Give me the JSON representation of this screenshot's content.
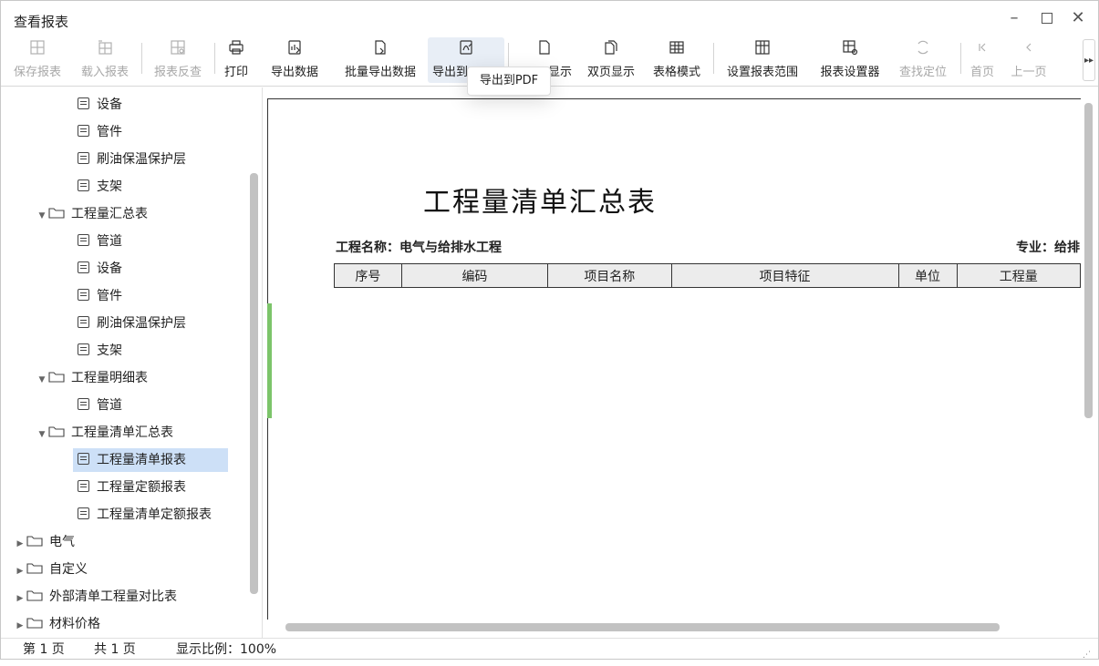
{
  "window": {
    "title": "查看报表"
  },
  "toolbar": {
    "buttons": [
      {
        "label": "保存报表",
        "icon": "grid-save-icon",
        "disabled": true
      },
      {
        "label": "载入报表",
        "icon": "grid-load-icon",
        "disabled": true
      },
      {
        "label": "报表反查",
        "icon": "grid-search-icon",
        "disabled": true
      },
      {
        "label": "打印",
        "icon": "printer-icon",
        "disabled": false
      },
      {
        "label": "导出数据",
        "icon": "export-data-icon",
        "disabled": false
      },
      {
        "label": "批量导出数据",
        "icon": "batch-export-icon",
        "disabled": false
      },
      {
        "label": "导出到PDF",
        "icon": "export-pdf-icon",
        "disabled": false
      },
      {
        "label": "单页显示",
        "icon": "single-page-icon",
        "disabled": false
      },
      {
        "label": "双页显示",
        "icon": "double-page-icon",
        "disabled": false
      },
      {
        "label": "表格模式",
        "icon": "table-mode-icon",
        "disabled": false
      },
      {
        "label": "设置报表范围",
        "icon": "report-range-icon",
        "disabled": false
      },
      {
        "label": "报表设置器",
        "icon": "report-settings-icon",
        "disabled": false
      },
      {
        "label": "查找定位",
        "icon": "find-locate-icon",
        "disabled": true
      },
      {
        "label": "首页",
        "icon": "first-page-icon",
        "disabled": true
      },
      {
        "label": "上一页",
        "icon": "prev-page-icon",
        "disabled": true
      }
    ],
    "export_pdf_visible": "导出到",
    "single_page_visible": "显示",
    "more": "▸▸"
  },
  "tooltip": {
    "text": "导出到PDF"
  },
  "tree": {
    "items": [
      {
        "label": "设备",
        "type": "doc",
        "level": 3
      },
      {
        "label": "管件",
        "type": "doc",
        "level": 3
      },
      {
        "label": "刷油保温保护层",
        "type": "doc",
        "level": 3
      },
      {
        "label": "支架",
        "type": "doc",
        "level": 3
      },
      {
        "label": "工程量汇总表",
        "type": "folder",
        "level": 2,
        "expanded": true
      },
      {
        "label": "管道",
        "type": "doc",
        "level": 3
      },
      {
        "label": "设备",
        "type": "doc",
        "level": 3
      },
      {
        "label": "管件",
        "type": "doc",
        "level": 3
      },
      {
        "label": "刷油保温保护层",
        "type": "doc",
        "level": 3
      },
      {
        "label": "支架",
        "type": "doc",
        "level": 3
      },
      {
        "label": "工程量明细表",
        "type": "folder",
        "level": 2,
        "expanded": true
      },
      {
        "label": "管道",
        "type": "doc",
        "level": 3
      },
      {
        "label": "工程量清单汇总表",
        "type": "folder",
        "level": 2,
        "expanded": true
      },
      {
        "label": "工程量清单报表",
        "type": "doc",
        "level": 3,
        "selected": true
      },
      {
        "label": "工程量定额报表",
        "type": "doc",
        "level": 3
      },
      {
        "label": "工程量清单定额报表",
        "type": "doc",
        "level": 3
      },
      {
        "label": "电气",
        "type": "folder",
        "level": 1,
        "expanded": false
      },
      {
        "label": "自定义",
        "type": "folder",
        "level": 1,
        "expanded": false
      },
      {
        "label": "外部清单工程量对比表",
        "type": "folder",
        "level": 1,
        "expanded": false
      },
      {
        "label": "材料价格",
        "type": "folder",
        "level": 1,
        "expanded": false
      }
    ]
  },
  "report": {
    "title": "工程量清单汇总表",
    "project_name": "工程名称：电气与给排水工程",
    "major": "专业：给排",
    "columns": [
      "序号",
      "编码",
      "项目名称",
      "项目特征",
      "单位",
      "工程量"
    ]
  },
  "status": {
    "page": "第 1 页",
    "total": "共 1 页",
    "zoom": "显示比例：100%"
  },
  "colors": {
    "selected_bg": "#cde0f7",
    "accent_green": "#7cc46a"
  }
}
